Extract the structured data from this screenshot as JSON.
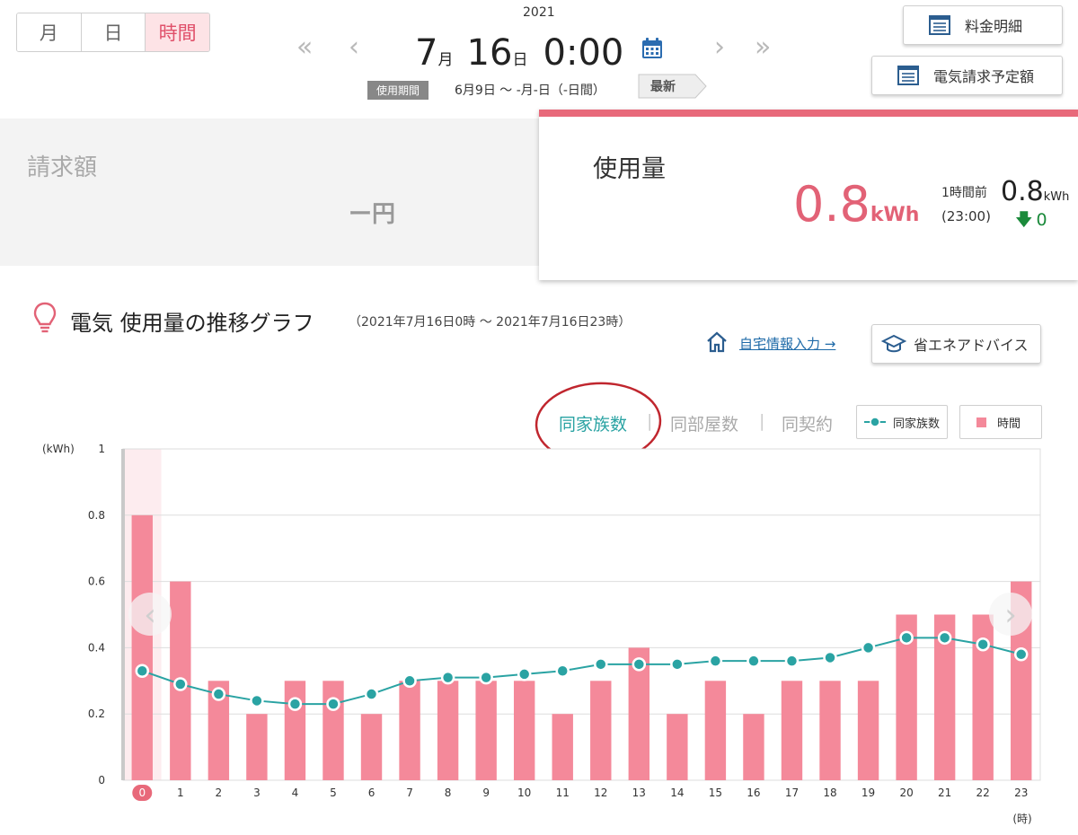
{
  "tabs": [
    {
      "label": "月",
      "active": false
    },
    {
      "label": "日",
      "active": false
    },
    {
      "label": "時間",
      "active": true
    }
  ],
  "date": {
    "year": "2021",
    "month": "7",
    "month_unit": "月",
    "day": "16",
    "day_unit": "日",
    "time": "0:00",
    "period_label": "使用期間",
    "period_value": "6月9日 ～ -月-日（-日間）",
    "latest_label": "最新"
  },
  "top_buttons": {
    "bill_detail": "料金明細",
    "bill_forecast": "電気請求予定額"
  },
  "billing": {
    "label": "請求額",
    "value": "ー円"
  },
  "usage": {
    "label": "使用量",
    "value": "0.8",
    "unit": "kWh",
    "prev_label": "1時間前",
    "prev_time": "(23:00)",
    "prev_value": "0.8",
    "prev_unit": "kWh",
    "diff": "0"
  },
  "graph": {
    "title": "電気 使用量の推移グラフ",
    "range": "（2021年7月16日0時 ～ 2021年7月16日23時）",
    "home_link": "自宅情報入力 →",
    "advice_button": "省エネアドバイス",
    "comparisons": [
      {
        "label": "同家族数",
        "active": true
      },
      {
        "label": "同部屋数",
        "active": false
      },
      {
        "label": "同契約",
        "active": false
      }
    ],
    "legend": {
      "line": "同家族数",
      "bar": "時間"
    }
  },
  "colors": {
    "accent_pink": "#e26276",
    "bar_pink": "#f4899a",
    "line_teal": "#2aa3a3",
    "down_green": "#1b8a3b"
  },
  "chart_data": {
    "type": "bar",
    "title": "",
    "ylabel": "(kWh)",
    "xlabel": "(時)",
    "ylim": [
      0,
      1
    ],
    "yticks": [
      0,
      0.2,
      0.4,
      0.6,
      0.8,
      1
    ],
    "categories": [
      "0",
      "1",
      "2",
      "3",
      "4",
      "5",
      "6",
      "7",
      "8",
      "9",
      "10",
      "11",
      "12",
      "13",
      "14",
      "15",
      "16",
      "17",
      "18",
      "19",
      "20",
      "21",
      "22",
      "23"
    ],
    "selected_category": "0",
    "grid": true,
    "series": [
      {
        "name": "時間",
        "kind": "bar",
        "color": "#f4899a",
        "values": [
          0.8,
          0.6,
          0.3,
          0.2,
          0.3,
          0.3,
          0.2,
          0.3,
          0.3,
          0.3,
          0.3,
          0.2,
          0.3,
          0.4,
          0.2,
          0.3,
          0.2,
          0.3,
          0.3,
          0.3,
          0.5,
          0.5,
          0.5,
          0.6
        ]
      },
      {
        "name": "同家族数",
        "kind": "line",
        "color": "#2aa3a3",
        "values": [
          0.33,
          0.29,
          0.26,
          0.24,
          0.23,
          0.23,
          0.26,
          0.3,
          0.31,
          0.31,
          0.32,
          0.33,
          0.35,
          0.35,
          0.35,
          0.36,
          0.36,
          0.36,
          0.37,
          0.4,
          0.43,
          0.43,
          0.41,
          0.38
        ]
      }
    ]
  }
}
